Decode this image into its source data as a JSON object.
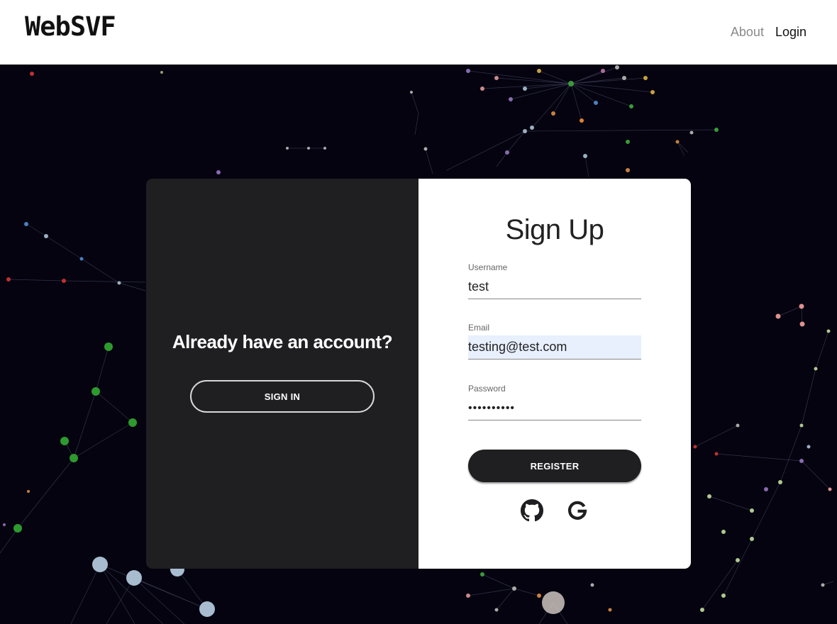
{
  "header": {
    "logo": "WebSVF",
    "nav": {
      "about": "About",
      "login": "Login"
    }
  },
  "left_panel": {
    "title": "Already have an account?",
    "signin_label": "SIGN IN"
  },
  "form": {
    "title": "Sign Up",
    "username": {
      "label": "Username",
      "value": "test"
    },
    "email": {
      "label": "Email",
      "value": "testing@test.com"
    },
    "password": {
      "label": "Password",
      "value": "••••••••••"
    },
    "register_label": "REGISTER"
  },
  "social_icons": [
    "github-icon",
    "google-icon"
  ],
  "colors": {
    "background_dark": "#04030f",
    "panel_dark": "#1f1f21",
    "autofill": "#e8f0fe"
  }
}
